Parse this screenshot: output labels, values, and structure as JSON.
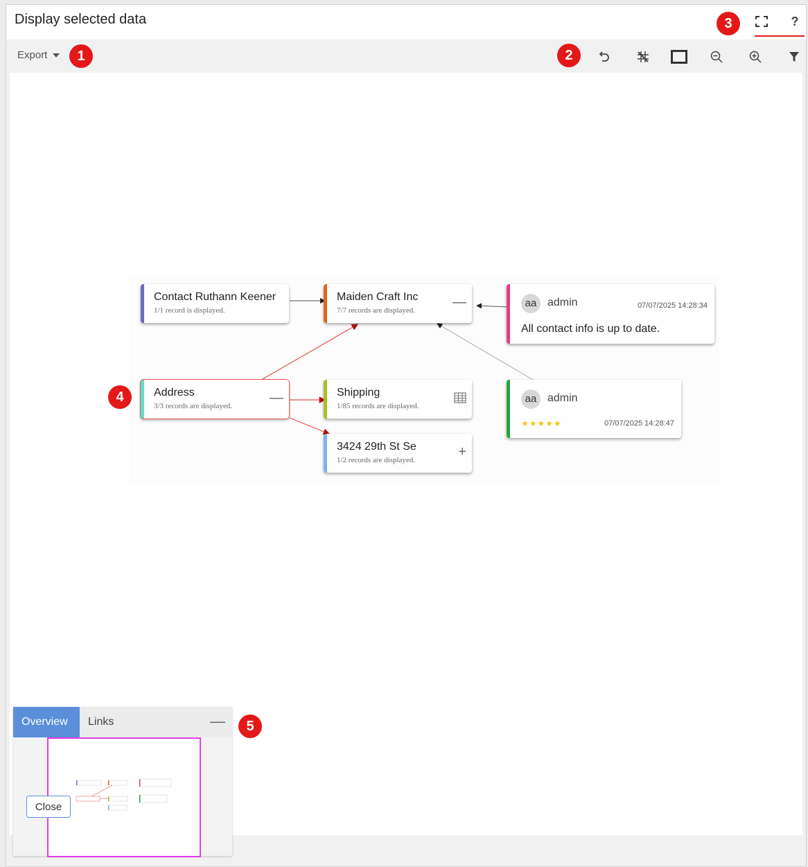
{
  "dialog": {
    "title": "Display selected data",
    "fullscreen_icon": "fullscreen-icon",
    "help_label": "?"
  },
  "toolbar": {
    "export_label": "Export",
    "tools": [
      "undo-icon",
      "hide-grid-icon",
      "frame-icon",
      "zoom-out-icon",
      "zoom-in-icon",
      "filter-icon"
    ]
  },
  "markers": [
    "1",
    "2",
    "3",
    "4",
    "5"
  ],
  "graph": {
    "nodes": {
      "contact": {
        "title": "Contact Ruthann Keener",
        "sub": "1/1 record is displayed.",
        "color": "#6b6bbf"
      },
      "maiden": {
        "title": "Maiden Craft Inc",
        "sub": "7/7 records are displayed.",
        "color": "#e0651e",
        "action": "—"
      },
      "address": {
        "title": "Address",
        "sub": "3/3 records are displayed.",
        "color": "#5fe0c8",
        "action": "—"
      },
      "shipping": {
        "title": "Shipping",
        "sub": "1/85 records are displayed.",
        "color": "#a8c020",
        "action_icon": "table-icon"
      },
      "street": {
        "title": "3424 29th St Se",
        "sub": "1/2 records are displayed.",
        "color": "#7ab6ea",
        "action": "+"
      }
    },
    "comments": [
      {
        "avatar": "aa",
        "user": "admin",
        "timestamp": "07/07/2025 14:28:34",
        "text": "All contact info is up to date.",
        "color": "#e23c8c"
      },
      {
        "avatar": "aa",
        "user": "admin",
        "timestamp": "07/07/2025 14:28:47",
        "stars": "★★★★★",
        "rating": 5,
        "color": "#2aa43c"
      }
    ]
  },
  "overview": {
    "tabs": [
      "Overview",
      "Links"
    ],
    "active_tab": "Overview",
    "minimize": "—"
  },
  "footer": {
    "close_label": "Close"
  },
  "colors": {
    "accent": "#5b8fd9",
    "marker": "#e41818",
    "viewport": "#e23de8"
  }
}
